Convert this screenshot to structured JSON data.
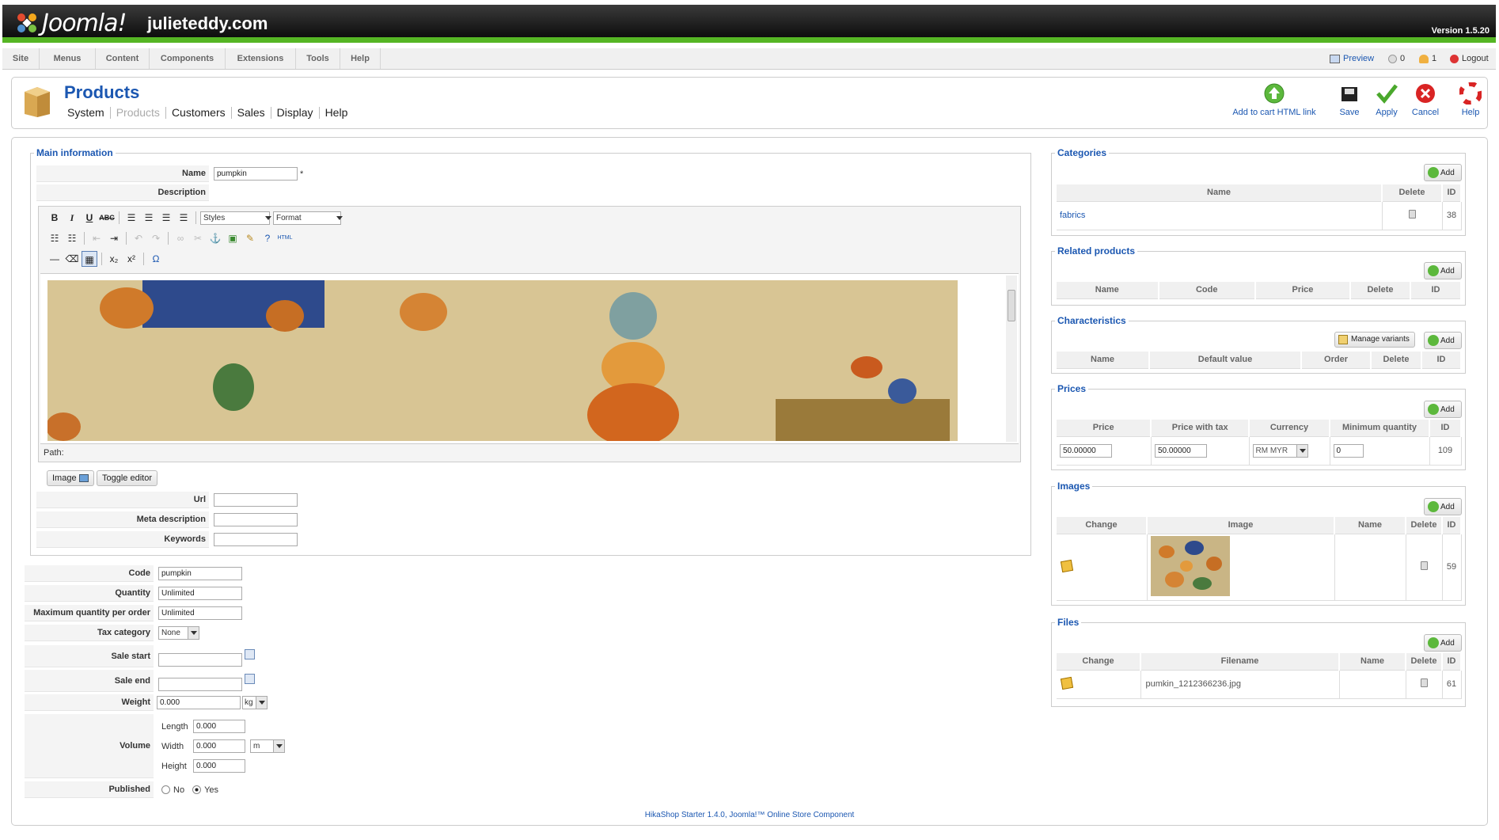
{
  "header": {
    "logo_text": "Joomla!",
    "site_name": "julieteddy.com",
    "version": "Version 1.5.20"
  },
  "menu": {
    "items": [
      "Site",
      "Menus",
      "Content",
      "Components",
      "Extensions",
      "Tools",
      "Help"
    ]
  },
  "system": {
    "preview": "Preview",
    "messages": "0",
    "users": "1",
    "logout": "Logout"
  },
  "page": {
    "title": "Products",
    "submenu": [
      "System",
      "Products",
      "Customers",
      "Sales",
      "Display",
      "Help"
    ]
  },
  "toolbar": {
    "add_link": "Add to cart HTML link",
    "save": "Save",
    "apply": "Apply",
    "cancel": "Cancel",
    "help": "Help"
  },
  "main": {
    "legend": "Main information",
    "name_label": "Name",
    "name_value": "pumpkin",
    "required": "*",
    "description_label": "Description",
    "editor": {
      "styles": "Styles",
      "format": "Format",
      "path": "Path:"
    },
    "image_btn": "Image",
    "toggle_btn": "Toggle editor",
    "url_label": "Url",
    "meta_label": "Meta description",
    "keywords_label": "Keywords"
  },
  "details": {
    "code_label": "Code",
    "code_value": "pumpkin",
    "quantity_label": "Quantity",
    "quantity_value": "Unlimited",
    "maxq_label": "Maximum quantity per order",
    "maxq_value": "Unlimited",
    "tax_label": "Tax category",
    "tax_value": "None",
    "sale_start_label": "Sale start",
    "sale_end_label": "Sale end",
    "weight_label": "Weight",
    "weight_value": "0.000",
    "weight_unit": "kg",
    "volume_label": "Volume",
    "length_label": "Length",
    "length_value": "0.000",
    "width_label": "Width",
    "width_value": "0.000",
    "width_unit": "m",
    "height_label": "Height",
    "height_value": "0.000",
    "published_label": "Published",
    "no": "No",
    "yes": "Yes"
  },
  "categories": {
    "legend": "Categories",
    "add": "Add",
    "headers": [
      "Name",
      "Delete",
      "ID"
    ],
    "rows": [
      {
        "name": "fabrics",
        "id": "38"
      }
    ]
  },
  "related": {
    "legend": "Related products",
    "add": "Add",
    "headers": [
      "Name",
      "Code",
      "Price",
      "Delete",
      "ID"
    ]
  },
  "characteristics": {
    "legend": "Characteristics",
    "manage": "Manage variants",
    "add": "Add",
    "headers": [
      "Name",
      "Default value",
      "Order",
      "Delete",
      "ID"
    ]
  },
  "prices": {
    "legend": "Prices",
    "add": "Add",
    "headers": [
      "Price",
      "Price with tax",
      "Currency",
      "Minimum quantity",
      "ID"
    ],
    "rows": [
      {
        "price": "50.00000",
        "price_tax": "50.00000",
        "currency": "RM MYR",
        "min_qty": "0",
        "id": "109"
      }
    ]
  },
  "images": {
    "legend": "Images",
    "add": "Add",
    "headers": [
      "Change",
      "Image",
      "Name",
      "Delete",
      "ID"
    ],
    "rows": [
      {
        "id": "59"
      }
    ]
  },
  "files": {
    "legend": "Files",
    "add": "Add",
    "headers": [
      "Change",
      "Filename",
      "Name",
      "Delete",
      "ID"
    ],
    "rows": [
      {
        "filename": "pumkin_1212366236.jpg",
        "id": "61"
      }
    ]
  },
  "footer": "HikaShop Starter 1.4.0, Joomla!™ Online Store Component",
  "colors": {
    "accent": "#1b57b1",
    "green_bar": "#55b524"
  }
}
